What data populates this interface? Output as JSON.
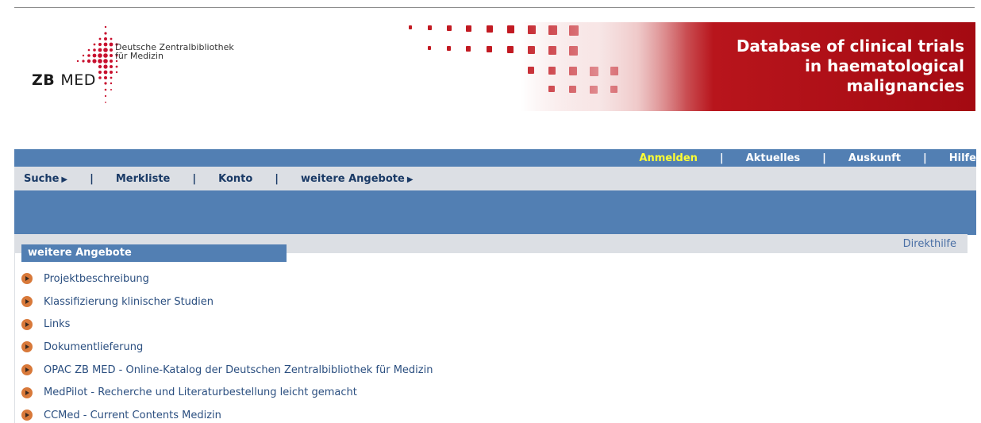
{
  "logo": {
    "abbr_zb": "ZB",
    "abbr_med": "MED",
    "line1": "Deutsche Zentralbibliothek",
    "line2": "für Medizin"
  },
  "banner": {
    "title_line1": "Database of clinical trials",
    "title_line2": "in haematological",
    "title_line3": "malignancies"
  },
  "nav_top": {
    "login": "Anmelden",
    "news": "Aktuelles",
    "info": "Auskunft",
    "help": "Hilfe"
  },
  "nav_main": {
    "search": "Suche",
    "watchlist": "Merkliste",
    "account": "Konto",
    "more": "weitere Angebote"
  },
  "content": {
    "direkthilfe": "Direkthilfe",
    "section_title": "weitere Angebote",
    "items": [
      "Projektbeschreibung",
      "Klassifizierung klinischer Studien",
      "Links",
      "Dokumentlieferung",
      "OPAC ZB MED - Online-Katalog der Deutschen Zentralbibliothek für Medizin",
      "MedPilot - Recherche und Literaturbestellung leicht gemacht",
      "CCMed - Current Contents Medizin"
    ]
  },
  "colors": {
    "nav_blue": "#527fb3",
    "nav_grey": "#dcdfe4",
    "banner_red": "#a40a12",
    "login_yellow": "#ffff33",
    "bullet_orange": "#d8793a"
  }
}
